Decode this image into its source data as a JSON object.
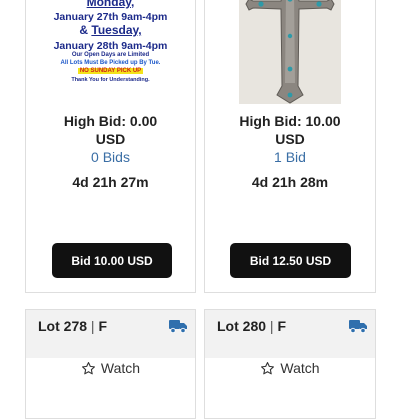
{
  "colors": {
    "link": "#3a6ea5",
    "button_bg": "#111111",
    "shipping_icon": "#2f6fad"
  },
  "flyer": {
    "line1": "Monday,",
    "line2": "January 27th 9am-4pm",
    "line3_prefix": "& ",
    "line3_day": "Tuesday,",
    "line4": "January 28th 9am-4pm",
    "line5": "Our Open Days are Limited",
    "line6": "All Lots Must Be Picked up By Tue.",
    "line7": "NO SUNDAY PICK UP",
    "line8": "Thank You for Understanding."
  },
  "cards": [
    {
      "high_bid": "High Bid: 0.00",
      "currency": "USD",
      "bids": "0 Bids",
      "time_left": "4d 21h 27m",
      "bid_button": "Bid 10.00 USD"
    },
    {
      "high_bid": "High Bid: 10.00",
      "currency": "USD",
      "bids": "1 Bid",
      "time_left": "4d 21h 28m",
      "bid_button": "Bid 12.50 USD"
    }
  ],
  "lots": [
    {
      "label": "Lot 278",
      "separator": "|",
      "flag": "F",
      "watch": "Watch",
      "shipping_icon": "truck-icon",
      "watch_icon": "star-icon"
    },
    {
      "label": "Lot 280",
      "separator": "|",
      "flag": "F",
      "watch": "Watch",
      "shipping_icon": "truck-icon",
      "watch_icon": "star-icon"
    }
  ]
}
